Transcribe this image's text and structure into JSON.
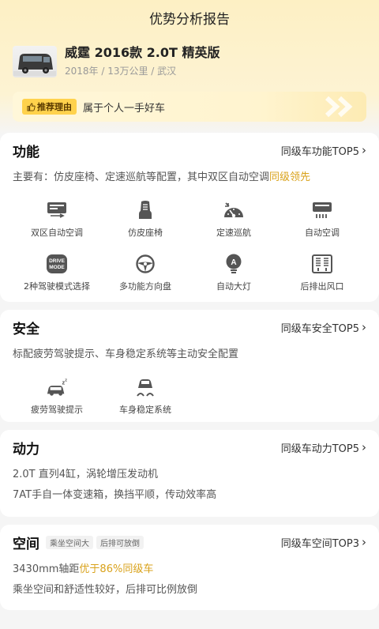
{
  "header": {
    "title": "优势分析报告"
  },
  "car": {
    "name": "威霆 2016款 2.0T 精英版",
    "meta": "2018年 / 13万公里 / 武汉"
  },
  "reason": {
    "tag": "推荐理由",
    "text": "属于个人一手好车"
  },
  "function": {
    "title": "功能",
    "link": "同级车功能TOP5",
    "desc_prefix": "主要有：仿皮座椅、定速巡航等配置，其中双区自动空调",
    "desc_highlight": "同级领先",
    "items": [
      {
        "label": "双区自动空调",
        "icon": "dual-zone-ac-icon"
      },
      {
        "label": "仿皮座椅",
        "icon": "leather-seat-icon"
      },
      {
        "label": "定速巡航",
        "icon": "cruise-control-icon"
      },
      {
        "label": "自动空调",
        "icon": "auto-ac-icon"
      },
      {
        "label": "2种驾驶模式选择",
        "icon": "drive-mode-icon"
      },
      {
        "label": "多功能方向盘",
        "icon": "steering-wheel-icon"
      },
      {
        "label": "自动大灯",
        "icon": "auto-headlight-icon"
      },
      {
        "label": "后排出风口",
        "icon": "rear-vent-icon"
      }
    ],
    "drive_mode_text": [
      "DRIVE",
      "MODE"
    ],
    "headlight_text": "A"
  },
  "safety": {
    "title": "安全",
    "link": "同级车安全TOP5",
    "desc": "标配疲劳驾驶提示、车身稳定系统等主动安全配置",
    "items": [
      {
        "label": "疲劳驾驶提示",
        "icon": "fatigue-alert-icon"
      },
      {
        "label": "车身稳定系统",
        "icon": "stability-control-icon"
      }
    ]
  },
  "power": {
    "title": "动力",
    "link": "同级车动力TOP5",
    "line1": "2.0T 直列4缸，涡轮增压发动机",
    "line2": "7AT手自一体变速箱，换挡平顺，传动效率高"
  },
  "space": {
    "title": "空间",
    "tags": [
      "乘坐空间大",
      "后排可放倒"
    ],
    "link": "同级车空间TOP3",
    "wheelbase_prefix": "3430mm轴距",
    "wheelbase_highlight": "优于86%同级车",
    "line2": "乘坐空间和舒适性较好，后排可比例放倒"
  },
  "colors": {
    "accent": "#d9a21b",
    "tag_bg": "#ffd24c",
    "icon": "#555555"
  }
}
